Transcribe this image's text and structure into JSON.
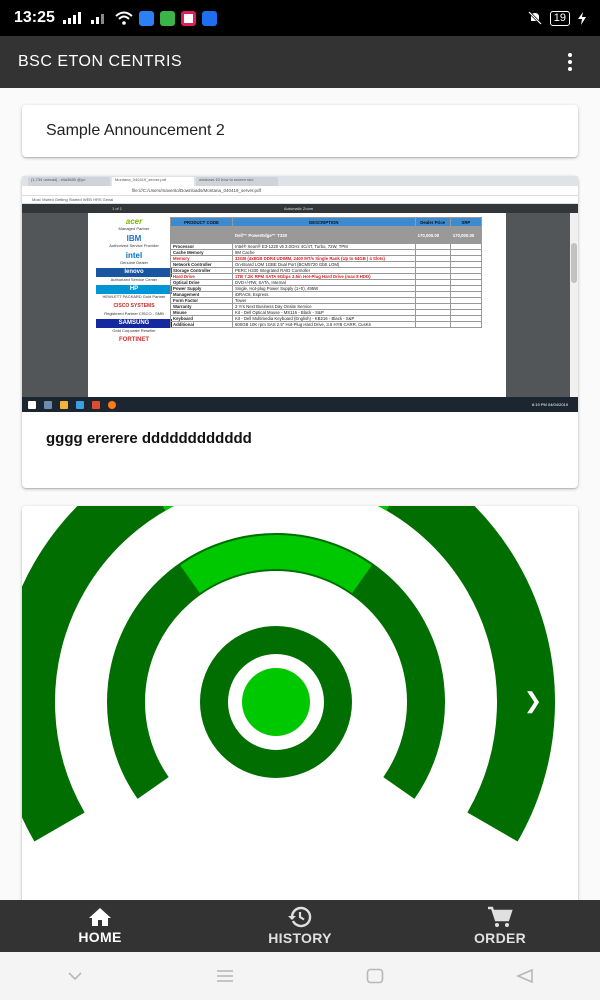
{
  "status_bar": {
    "time": "13:25",
    "battery": "19"
  },
  "app_bar": {
    "title": "BSC ETON CENTRIS"
  },
  "announcements": [
    {
      "title": "Sample Announcement 2"
    },
    {
      "text": "gggg ererere dddddddddddd",
      "screenshot": {
        "tabs": [
          "(1,734 unread) - ella3680 @yo",
          "Montana_040419_server.pdf",
          "windows 10 how to screen sho"
        ],
        "url": "file:///C:/Users/maverito/Downloads/Montana_040419_server.pdf",
        "bookmarks": "Most Visited   Getting Started   WEB HRS   Genal",
        "pdf_zoom": "Automatic Zoom",
        "pdf_page": "1 of 1",
        "taskbar_clock": "6:19 PM 04/04/2019",
        "logos": [
          {
            "mark": "acer",
            "caption": "Managed Partner"
          },
          {
            "mark": "IBM",
            "caption": "Authorized Service Provider"
          },
          {
            "mark": "intel",
            "caption": "Genuine Dealer"
          },
          {
            "mark": "lenovo",
            "caption": "Authorized Service Center"
          },
          {
            "mark": "HP",
            "caption": "HEWLETT PACKARD Gold Partner"
          },
          {
            "mark": "CISCO SYSTEMS",
            "caption": "Registered Partner CISCO - SMB"
          },
          {
            "mark": "SAMSUNG",
            "caption": "Gold Corporate Reseller"
          },
          {
            "mark": "FORTINET",
            "caption": ""
          }
        ],
        "table": {
          "headers": [
            "PRODUCT CODE",
            "DESCRIPTION",
            "Dealer Price",
            "SRP"
          ],
          "model": "Dell™ PowerEdge™ T330",
          "dealer_price": "170,000.00",
          "srp": "170,000.00",
          "rows": [
            {
              "label": "Processor",
              "value": "Intel® Xeon® E3-1220 v6 3.0GHz 4C/4T, Turbo, 72W, TPM",
              "highlight": false
            },
            {
              "label": "Cache Memory",
              "value": "8M Cache",
              "highlight": false
            },
            {
              "label": "Memory",
              "value": "32GB (4x8GB DDR4 UDIMM, 2400 MT/s Single Rank (Up to 64GB | 4 Slots)",
              "highlight": true
            },
            {
              "label": "Network Controller",
              "value": "On-Board LOM 1GBE Dual Port (BCM5720 GbE LOM)",
              "highlight": false
            },
            {
              "label": "Storage Controller",
              "value": "PERC H330 Integrated RAID Controller",
              "highlight": false
            },
            {
              "label": "Hard Drive",
              "value": "1TB 7.2K RPM SATA 6Gbps 3.5in Hot-Plug Hard Drive (max 8 HDD)",
              "highlight": true
            },
            {
              "label": "Optical Drive",
              "value": "DVD+/-RW, SATA, Internal",
              "highlight": false
            },
            {
              "label": "Power Supply",
              "value": "Single, Hot-plug Power Supply (1+0), 495W",
              "highlight": false
            },
            {
              "label": "Management",
              "value": "iDRAC8, Express",
              "highlight": false
            },
            {
              "label": "Form Factor",
              "value": "Tower",
              "highlight": false
            },
            {
              "label": "Warranty",
              "value": "3 Yrs Next Business Day Onsite Service",
              "highlight": false
            },
            {
              "label": "Mouse",
              "value": "Kit - Dell Optical Mouse - MS116 - Black - S&P",
              "highlight": false
            },
            {
              "label": "Keyboard",
              "value": "Kit - Dell Multimedia Keyboard (English) - KB216 - Black - S&P",
              "highlight": false
            },
            {
              "label": "Additional",
              "value": "600GB 10K rpm SAS 2.5\" Hot-Plug Hard Drive, 3.5 HYB CARR, CusKit",
              "highlight": false
            }
          ]
        }
      }
    }
  ],
  "carousel": {
    "colors": {
      "light": "#00c800",
      "dark": "#006e00"
    },
    "prev_icon": "chevron-left-icon",
    "next_icon": "chevron-right-icon",
    "slide_count": 2,
    "active_slide": 1
  },
  "bottom_nav": [
    {
      "icon": "home-icon",
      "label": "HOME",
      "active": true
    },
    {
      "icon": "history-icon",
      "label": "HISTORY",
      "active": false
    },
    {
      "icon": "cart-icon",
      "label": "ORDER",
      "active": false
    }
  ]
}
